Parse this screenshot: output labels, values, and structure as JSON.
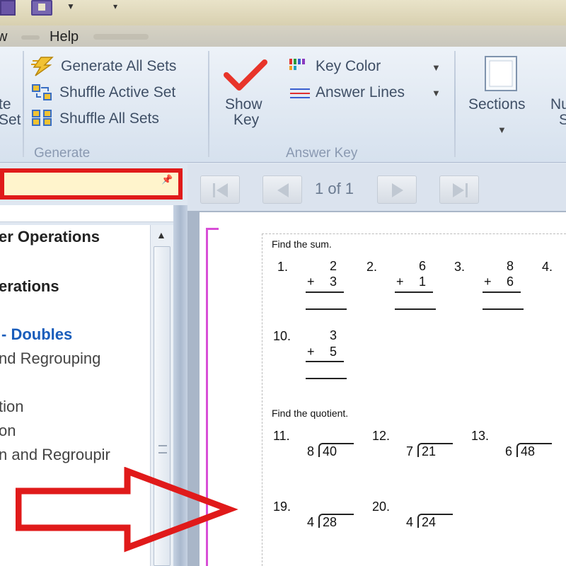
{
  "menu": {
    "view": "w",
    "help": "Help"
  },
  "ribbon": {
    "left_partial": [
      "te",
      "Set"
    ],
    "generate_group": {
      "label": "Generate",
      "items": [
        {
          "label": "Generate All Sets",
          "icon": "lightning-icon"
        },
        {
          "label": "Shuffle Active Set",
          "icon": "shuffle-icon"
        },
        {
          "label": "Shuffle All Sets",
          "icon": "shuffle-all-icon"
        }
      ]
    },
    "answer_key_group": {
      "label": "Answer Key",
      "show_key": [
        "Show",
        "Key"
      ],
      "key_color": "Key Color",
      "answer_lines": "Answer Lines"
    },
    "sections_label": "Sections",
    "next_partial": [
      "Nu",
      "S"
    ]
  },
  "nav": {
    "items": [
      {
        "label": "er Operations",
        "style": "bold"
      },
      {
        "label": "erations",
        "style": "bold"
      },
      {
        "label": "- Doubles",
        "style": "blue"
      },
      {
        "label": "nd Regrouping",
        "style": "normal"
      },
      {
        "label": "tion",
        "style": "normal"
      },
      {
        "label": "on",
        "style": "normal"
      },
      {
        "label": "n and Regroupir",
        "style": "normal"
      }
    ]
  },
  "preview": {
    "page_indicator": "1 of 1"
  },
  "worksheet": {
    "section1_instruction": "Find the sum.",
    "addition": [
      {
        "num": "1.",
        "top": "2",
        "op": "+",
        "bottom": "3"
      },
      {
        "num": "2.",
        "top": "6",
        "op": "+",
        "bottom": "1"
      },
      {
        "num": "3.",
        "top": "8",
        "op": "+",
        "bottom": "6"
      },
      {
        "num": "4."
      },
      {
        "num": "10.",
        "top": "3",
        "op": "+",
        "bottom": "5"
      }
    ],
    "section2_instruction": "Find the quotient.",
    "division": [
      {
        "num": "11.",
        "divisor": "8",
        "dividend": "40"
      },
      {
        "num": "12.",
        "divisor": "7",
        "dividend": "21"
      },
      {
        "num": "13.",
        "divisor": "6",
        "dividend": "48"
      },
      {
        "num": "19.",
        "divisor": "4",
        "dividend": "28"
      },
      {
        "num": "20.",
        "divisor": "4",
        "dividend": "24"
      }
    ]
  },
  "colors": {
    "highlight_red": "#e01a1a",
    "margin_magenta": "#d84ed6",
    "nav_blue": "#1a5dbb"
  }
}
